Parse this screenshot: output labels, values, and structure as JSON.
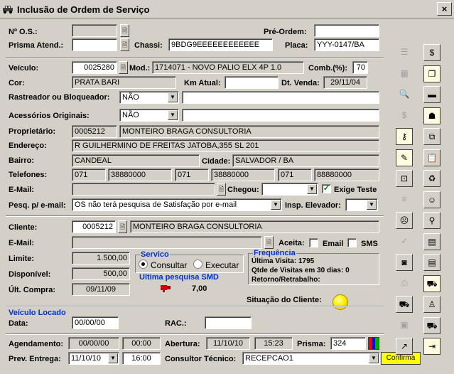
{
  "window": {
    "title": "Inclusão de Ordem de Serviço",
    "close": "×"
  },
  "os": {
    "label": "Nº O.S.:",
    "value": ""
  },
  "preordem": {
    "label": "Pré-Ordem:",
    "value": ""
  },
  "prisma_atend": {
    "label": "Prisma Atend.:",
    "value": ""
  },
  "chassi": {
    "label": "Chassi:",
    "value": "9BDG9EEEEEEEEEEEE"
  },
  "placa": {
    "label": "Placa:",
    "value": "YYY-0147/BA"
  },
  "veiculo": {
    "label": "Veículo:",
    "value": "0025280"
  },
  "mod": {
    "label": "Mod.:",
    "value": "1714071 - NOVO PALIO ELX 4P 1.0"
  },
  "comb": {
    "label": "Comb.(%):",
    "value": "70"
  },
  "cor": {
    "label": "Cor:",
    "value": "PRATA BARI"
  },
  "km_atual": {
    "label": "Km Atual:",
    "value": ""
  },
  "dt_venda": {
    "label": "Dt. Venda:",
    "value": "29/11/04"
  },
  "rastreador": {
    "label": "Rastreador ou Bloqueador:",
    "value": "NÃO",
    "obs": ""
  },
  "acessorios": {
    "label": "Acessórios Originais:",
    "value": "NÃO",
    "obs": ""
  },
  "proprietario": {
    "label": "Proprietário:",
    "code": "0005212",
    "name": "MONTEIRO BRAGA CONSULTORIA"
  },
  "endereco": {
    "label": "Endereço:",
    "value": "R GUILHERMINO DE FREITAS JATOBA,355 SL 201"
  },
  "bairro": {
    "label": "Bairro:",
    "value": "CANDEAL"
  },
  "cidade": {
    "label": "Cidade:",
    "value": "SALVADOR / BA"
  },
  "telefones": {
    "label": "Telefones:",
    "items": [
      {
        "ddd": "071",
        "num": "38880000"
      },
      {
        "ddd": "071",
        "num": "38880000"
      },
      {
        "ddd": "071",
        "num": "88880000"
      }
    ]
  },
  "email1": {
    "label": "E-Mail:",
    "value": ""
  },
  "chegou": {
    "label": "Chegou:",
    "value": ""
  },
  "exige_teste": {
    "label": "Exige Teste",
    "checked": true,
    "mark": "✓"
  },
  "pesq_email": {
    "label": "Pesq. p/ e-mail:",
    "value": "OS não terá pesquisa de Satisfação por e-mail"
  },
  "insp_elevador": {
    "label": "Insp. Elevador:",
    "value": ""
  },
  "cliente": {
    "label": "Cliente:",
    "code": "0005212",
    "name": "MONTEIRO BRAGA CONSULTORIA"
  },
  "email2": {
    "label": "E-Mail:",
    "value": ""
  },
  "aceita": {
    "label": "Aceita:",
    "email_label": "Email",
    "sms_label": "SMS"
  },
  "limite": {
    "label": "Limite:",
    "value": "1.500,00"
  },
  "disponivel": {
    "label": "Disponível:",
    "value": "500,00"
  },
  "ult_compra": {
    "label": "Últ. Compra:",
    "value": "09/11/09"
  },
  "servico": {
    "title": "Servico",
    "consultar": "Consultar",
    "executar": "Executar",
    "selected": "consultar"
  },
  "ultima_pesquisa": {
    "title": "Ultima pesquisa SMD",
    "value": "7,00"
  },
  "frequencia": {
    "title": "Frequência",
    "ultima_visita": "Última Visita: 1795",
    "qtde_visitas": "Qtde de Visitas em 30 dias: 0",
    "retorno": "Retorno/Retrabalho:"
  },
  "situacao": {
    "label": "Situação do Cliente:"
  },
  "veiculo_locado": {
    "title": "Veículo Locado",
    "data_label": "Data:",
    "data_value": "00/00/00",
    "rac_label": "RAC.:",
    "rac_value": ""
  },
  "agendamento": {
    "label": "Agendamento:",
    "date": "00/00/00",
    "time": "00:00"
  },
  "abertura": {
    "label": "Abertura:",
    "date": "11/10/10",
    "time": "15:23"
  },
  "prisma": {
    "label": "Prisma:",
    "value": "324"
  },
  "prev_entrega": {
    "label": "Prev. Entrega:",
    "date": "11/10/10",
    "time": "16:00"
  },
  "consultor": {
    "label": "Consultor Técnico:",
    "value": "RECEPCAO1"
  },
  "confirma": {
    "label": "Confirma"
  },
  "colors": {
    "section_title": "#0033cc",
    "indicator": "#ffee00",
    "background": "#d4d0c8"
  },
  "toolbar": [
    "list-icon",
    "money-bag-icon",
    "table-icon",
    "copy-yellow-icon",
    "search-document-icon",
    "car-icon",
    "dollar-icon",
    "person-chart-icon",
    "key-person-icon",
    "duplicate-icon",
    "document-edit-icon",
    "clipboard-icon",
    "inbox-icon",
    "recycle-icon",
    "lines-icon",
    "smiley-icon",
    "sad-face-icon",
    "faucet-icon",
    "check-icon",
    "stack-icon",
    "camera-icon",
    "page-icon",
    "printer-icon",
    "car-lift-icon",
    "tow-truck-icon",
    "stamp-icon",
    "layers-icon",
    "tow-car-icon",
    "exit-arrow-icon",
    "door-exit-icon"
  ]
}
